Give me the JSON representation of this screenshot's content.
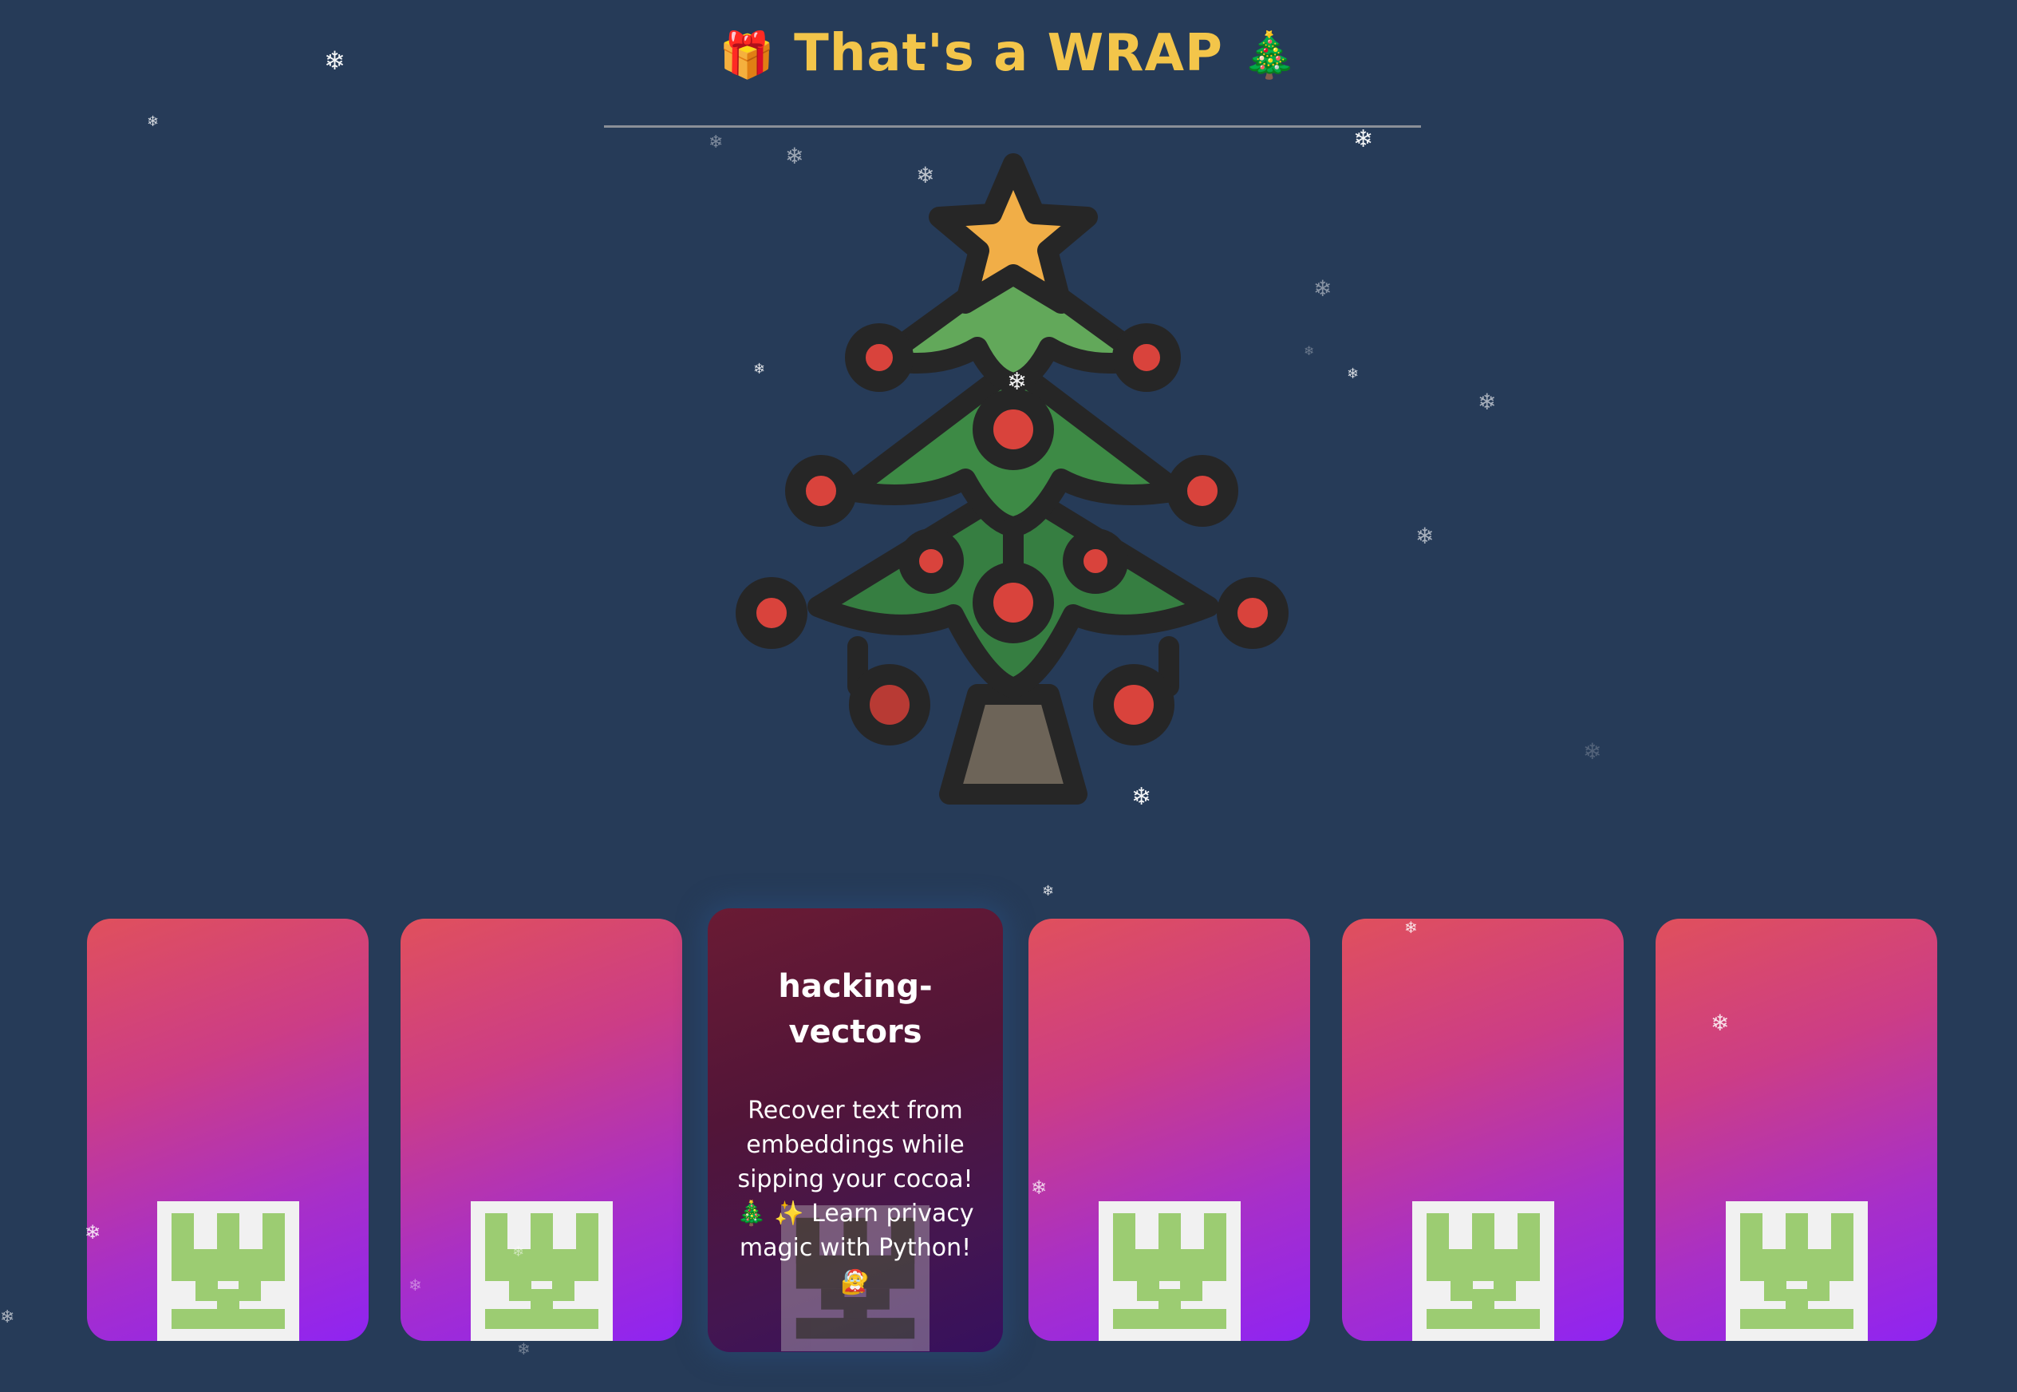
{
  "header": {
    "title": "That's a WRAP",
    "emoji_left": "🎁",
    "emoji_right": "🎄"
  },
  "colors": {
    "background": "#263b58",
    "title": "#f3c54a",
    "card_gradient_start": "#e0505c",
    "card_gradient_end": "#8f24f2",
    "active_card_start": "#6a1b34",
    "active_card_end": "#36105e",
    "castle_green": "#9ccc72"
  },
  "snowflake_glyph": "❄",
  "cards": [
    {
      "label": ""
    },
    {
      "label": ""
    },
    {
      "title": "hacking-\nvectors",
      "description": "Recover text from embeddings while sipping your cocoa! 🎄 ✨ Learn privacy magic with Python! 🔐",
      "avatar_emoji": "🤶"
    },
    {
      "label": ""
    },
    {
      "label": ""
    },
    {
      "label": ""
    }
  ],
  "icons": {
    "tree": "christmas-tree-icon",
    "castle": "castle-icon",
    "snowflake": "snowflake-icon"
  }
}
